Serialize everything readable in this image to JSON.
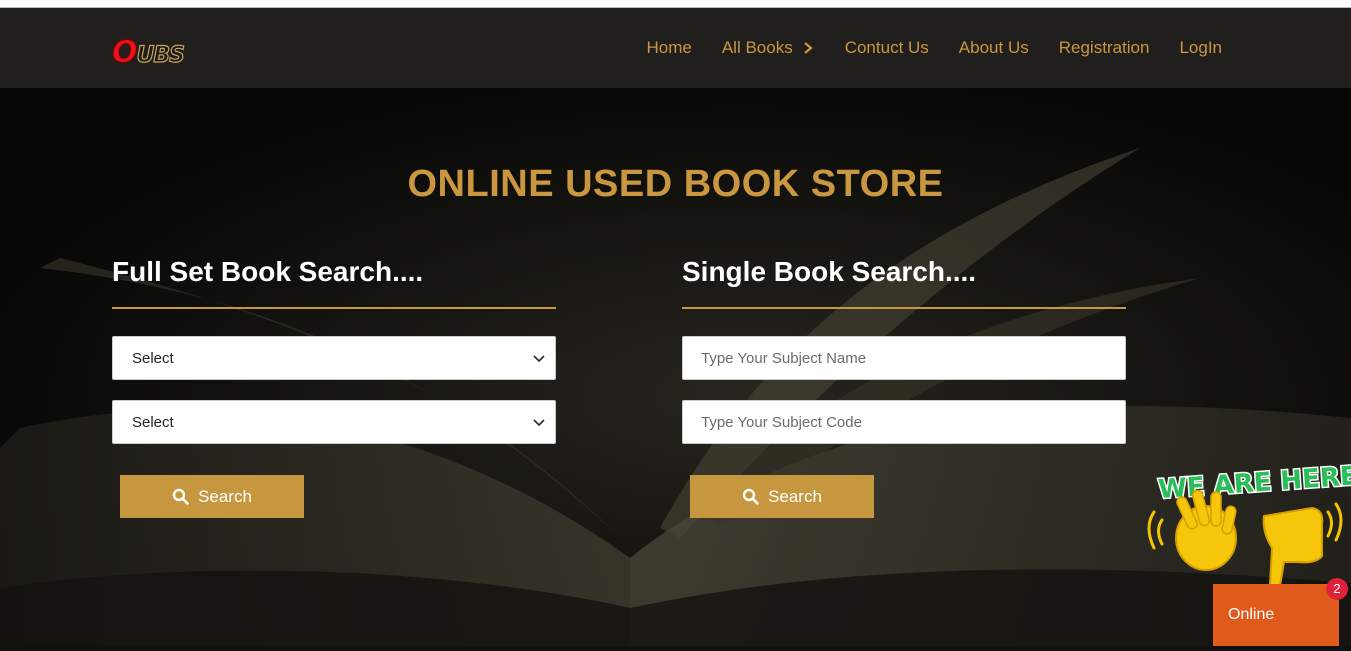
{
  "brand": {
    "logo_initial": "O",
    "logo_rest": "UBS"
  },
  "nav": {
    "items": [
      {
        "label": "Home"
      },
      {
        "label": "All Books"
      },
      {
        "label": "Contuct Us"
      },
      {
        "label": "About Us"
      },
      {
        "label": "Registration"
      },
      {
        "label": "LogIn"
      }
    ]
  },
  "hero": {
    "title": "ONLINE USED BOOK STORE",
    "full_set": {
      "heading": "Full Set Book Search....",
      "select1_value": "Select",
      "select2_value": "Select",
      "button_label": "Search"
    },
    "single": {
      "heading": "Single Book Search....",
      "subject_name_placeholder": "Type Your Subject Name",
      "subject_code_placeholder": "Type Your Subject Code",
      "button_label": "Search"
    }
  },
  "chat_widget": {
    "banner": "WE ARE HERE!",
    "status_label": "Online",
    "notification_count": "2"
  },
  "colors": {
    "accent": "#c9973f",
    "navbar": "#211f1e",
    "online": "#e05a1c",
    "badge": "#e0213a"
  }
}
